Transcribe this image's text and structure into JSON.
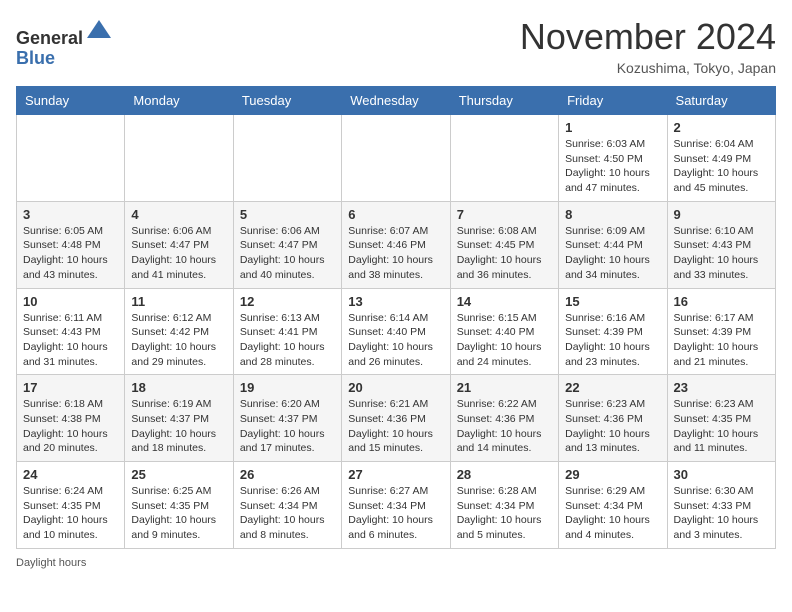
{
  "header": {
    "logo_line1": "General",
    "logo_line2": "Blue",
    "month": "November 2024",
    "location": "Kozushima, Tokyo, Japan"
  },
  "weekdays": [
    "Sunday",
    "Monday",
    "Tuesday",
    "Wednesday",
    "Thursday",
    "Friday",
    "Saturday"
  ],
  "weeks": [
    [
      {
        "day": "",
        "info": ""
      },
      {
        "day": "",
        "info": ""
      },
      {
        "day": "",
        "info": ""
      },
      {
        "day": "",
        "info": ""
      },
      {
        "day": "",
        "info": ""
      },
      {
        "day": "1",
        "info": "Sunrise: 6:03 AM\nSunset: 4:50 PM\nDaylight: 10 hours and 47 minutes."
      },
      {
        "day": "2",
        "info": "Sunrise: 6:04 AM\nSunset: 4:49 PM\nDaylight: 10 hours and 45 minutes."
      }
    ],
    [
      {
        "day": "3",
        "info": "Sunrise: 6:05 AM\nSunset: 4:48 PM\nDaylight: 10 hours and 43 minutes."
      },
      {
        "day": "4",
        "info": "Sunrise: 6:06 AM\nSunset: 4:47 PM\nDaylight: 10 hours and 41 minutes."
      },
      {
        "day": "5",
        "info": "Sunrise: 6:06 AM\nSunset: 4:47 PM\nDaylight: 10 hours and 40 minutes."
      },
      {
        "day": "6",
        "info": "Sunrise: 6:07 AM\nSunset: 4:46 PM\nDaylight: 10 hours and 38 minutes."
      },
      {
        "day": "7",
        "info": "Sunrise: 6:08 AM\nSunset: 4:45 PM\nDaylight: 10 hours and 36 minutes."
      },
      {
        "day": "8",
        "info": "Sunrise: 6:09 AM\nSunset: 4:44 PM\nDaylight: 10 hours and 34 minutes."
      },
      {
        "day": "9",
        "info": "Sunrise: 6:10 AM\nSunset: 4:43 PM\nDaylight: 10 hours and 33 minutes."
      }
    ],
    [
      {
        "day": "10",
        "info": "Sunrise: 6:11 AM\nSunset: 4:43 PM\nDaylight: 10 hours and 31 minutes."
      },
      {
        "day": "11",
        "info": "Sunrise: 6:12 AM\nSunset: 4:42 PM\nDaylight: 10 hours and 29 minutes."
      },
      {
        "day": "12",
        "info": "Sunrise: 6:13 AM\nSunset: 4:41 PM\nDaylight: 10 hours and 28 minutes."
      },
      {
        "day": "13",
        "info": "Sunrise: 6:14 AM\nSunset: 4:40 PM\nDaylight: 10 hours and 26 minutes."
      },
      {
        "day": "14",
        "info": "Sunrise: 6:15 AM\nSunset: 4:40 PM\nDaylight: 10 hours and 24 minutes."
      },
      {
        "day": "15",
        "info": "Sunrise: 6:16 AM\nSunset: 4:39 PM\nDaylight: 10 hours and 23 minutes."
      },
      {
        "day": "16",
        "info": "Sunrise: 6:17 AM\nSunset: 4:39 PM\nDaylight: 10 hours and 21 minutes."
      }
    ],
    [
      {
        "day": "17",
        "info": "Sunrise: 6:18 AM\nSunset: 4:38 PM\nDaylight: 10 hours and 20 minutes."
      },
      {
        "day": "18",
        "info": "Sunrise: 6:19 AM\nSunset: 4:37 PM\nDaylight: 10 hours and 18 minutes."
      },
      {
        "day": "19",
        "info": "Sunrise: 6:20 AM\nSunset: 4:37 PM\nDaylight: 10 hours and 17 minutes."
      },
      {
        "day": "20",
        "info": "Sunrise: 6:21 AM\nSunset: 4:36 PM\nDaylight: 10 hours and 15 minutes."
      },
      {
        "day": "21",
        "info": "Sunrise: 6:22 AM\nSunset: 4:36 PM\nDaylight: 10 hours and 14 minutes."
      },
      {
        "day": "22",
        "info": "Sunrise: 6:23 AM\nSunset: 4:36 PM\nDaylight: 10 hours and 13 minutes."
      },
      {
        "day": "23",
        "info": "Sunrise: 6:23 AM\nSunset: 4:35 PM\nDaylight: 10 hours and 11 minutes."
      }
    ],
    [
      {
        "day": "24",
        "info": "Sunrise: 6:24 AM\nSunset: 4:35 PM\nDaylight: 10 hours and 10 minutes."
      },
      {
        "day": "25",
        "info": "Sunrise: 6:25 AM\nSunset: 4:35 PM\nDaylight: 10 hours and 9 minutes."
      },
      {
        "day": "26",
        "info": "Sunrise: 6:26 AM\nSunset: 4:34 PM\nDaylight: 10 hours and 8 minutes."
      },
      {
        "day": "27",
        "info": "Sunrise: 6:27 AM\nSunset: 4:34 PM\nDaylight: 10 hours and 6 minutes."
      },
      {
        "day": "28",
        "info": "Sunrise: 6:28 AM\nSunset: 4:34 PM\nDaylight: 10 hours and 5 minutes."
      },
      {
        "day": "29",
        "info": "Sunrise: 6:29 AM\nSunset: 4:34 PM\nDaylight: 10 hours and 4 minutes."
      },
      {
        "day": "30",
        "info": "Sunrise: 6:30 AM\nSunset: 4:33 PM\nDaylight: 10 hours and 3 minutes."
      }
    ]
  ],
  "footer": "Daylight hours"
}
